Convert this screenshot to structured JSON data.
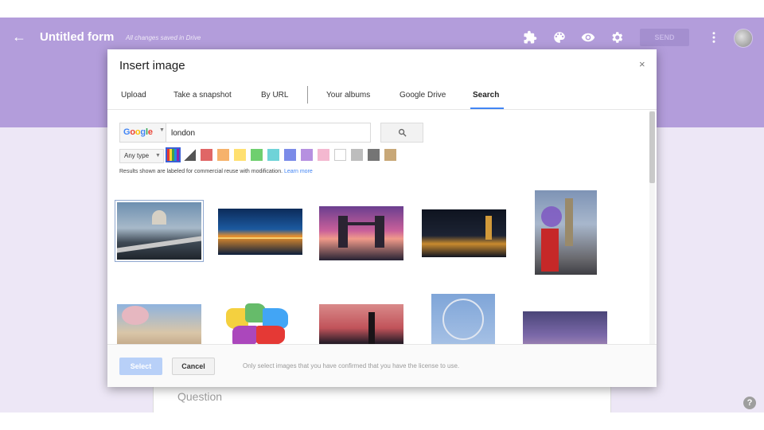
{
  "header": {
    "form_title": "Untitled form",
    "save_status": "All changes saved in Drive",
    "send_label": "SEND",
    "accent_color": "#b39ddb"
  },
  "dialog": {
    "title": "Insert image",
    "close_glyph": "×",
    "tabs": [
      {
        "label": "Upload"
      },
      {
        "label": "Take a snapshot"
      },
      {
        "label": "By URL"
      },
      {
        "label": "Your albums"
      },
      {
        "label": "Google Drive"
      },
      {
        "label": "Search",
        "active": true
      }
    ],
    "search": {
      "engine": "Google",
      "query": "london",
      "button_icon": "search-icon"
    },
    "filters": {
      "type_label": "Any type",
      "colors": [
        "full-color",
        "black-and-white",
        "#e06666",
        "#f6b26b",
        "#ffe070",
        "#6fcf6f",
        "#6fd3d8",
        "#7b8be8",
        "#b690e0",
        "#f4b8d0",
        "#ffffff",
        "#bdbdbd",
        "#757575",
        "#c8a878"
      ]
    },
    "notice": "Results shown are labeled for commercial reuse with modification.",
    "notice_link": "Learn more",
    "footer": {
      "select_label": "Select",
      "cancel_label": "Cancel",
      "note": "Only select images that you have confirmed that you have the license to use."
    }
  },
  "form": {
    "question_placeholder": "Question"
  },
  "help_glyph": "?"
}
